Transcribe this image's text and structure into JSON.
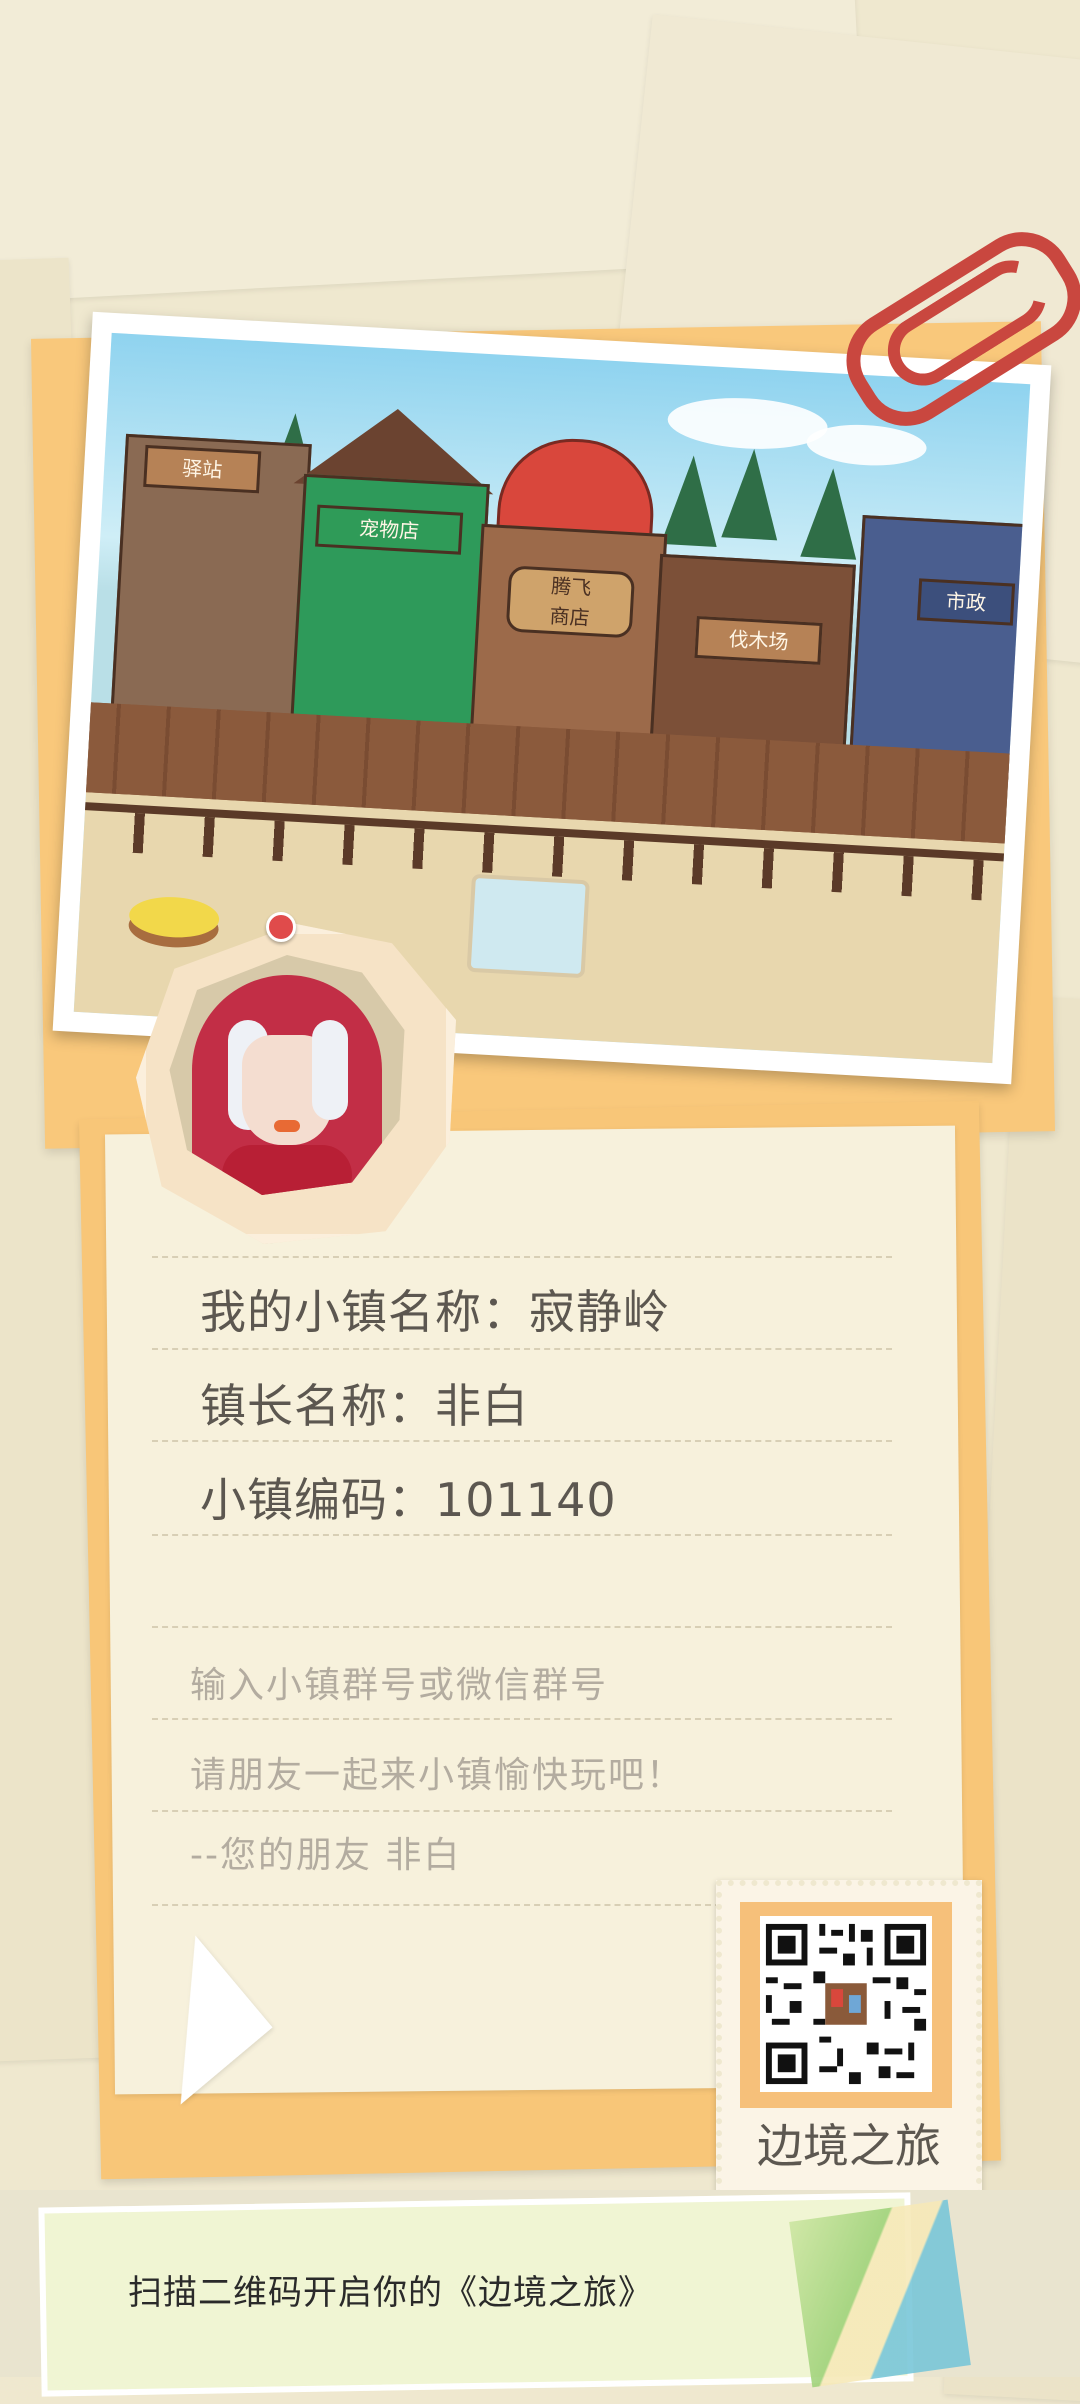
{
  "town_info": {
    "town_name_label": "我的小镇名称：寂静岭",
    "mayor_label": "镇长名称：非白",
    "town_code_label": "小镇编码：101140"
  },
  "message": {
    "line1": "输入小镇群号或微信群号",
    "line2": "请朋友一起来小镇愉快玩吧！",
    "line3": "--您的朋友  非白"
  },
  "scene_signs": {
    "station": "驿站",
    "pet_shop": "宠物店",
    "shop_top": "腾飞",
    "shop_bottom": "商店",
    "lumber": "伐木场",
    "market": "市政"
  },
  "stamp": {
    "title": "边境之旅",
    "qr_icon": "qr-code-icon"
  },
  "footer": {
    "cta": "扫描二维码开启你的《边境之旅》"
  },
  "colors": {
    "background": "#efe8cf",
    "orange": "#f9c87b",
    "paperclip": "#c9473f",
    "text_primary": "#5c5750",
    "text_secondary": "#b3aca0"
  }
}
